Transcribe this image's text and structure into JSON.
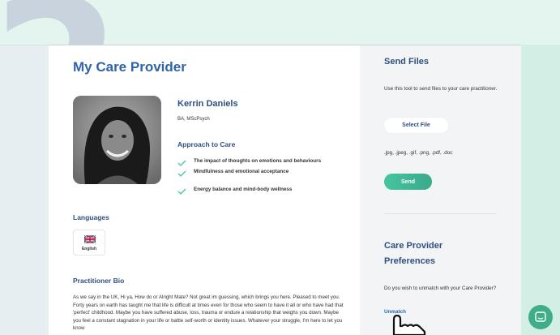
{
  "step_number": "2",
  "main": {
    "title": "My Care Provider",
    "provider": {
      "name": "Kerrin Daniels",
      "qualifications": "BA, MScPsych"
    },
    "approach": {
      "heading": "Approach to Care",
      "items": [
        "The impact of thoughts on emotions and behaviours",
        "Mindfulness and emotional acceptance",
        "Energy balance and mind-body wellness"
      ]
    },
    "languages": {
      "heading": "Languages",
      "items": [
        {
          "label": "English",
          "icon": "uk-flag-icon"
        }
      ]
    },
    "bio": {
      "heading": "Practitioner Bio",
      "text": "As we say in the UK, Hi ya, How do or Alright Mate? Not great im guessing, which brings you here. Pleased to meet you. Forty years on earth has taught me that life is difficult at times even for those who seem to have it all or who have had that 'perfect' childhood. Maybe you have suffered abuse, loss, trauma or endure a relationship that weighs you down. Maybe you feel a constant stagnation in your life or battle self-worth or identity issues. Whatever your struggle, I'm here to let you know"
    }
  },
  "side": {
    "send_files": {
      "title": "Send Files",
      "description": "Use this tool to send files to your care practitioner.",
      "select_label": "Select File",
      "file_types": ".jpg, .jpeg, .gif, .png, .pdf, .doc",
      "send_label": "Send"
    },
    "preferences": {
      "title": "Care Provider Preferences",
      "description": "Do you wish to unmatch with your Care Provider?",
      "unmatch_label": "Unmatch"
    }
  },
  "colors": {
    "accent_blue": "#2f63ac",
    "heading_navy": "#2f4f7f",
    "accent_green": "#45c4a0",
    "background_mint": "#e4f4ee"
  }
}
